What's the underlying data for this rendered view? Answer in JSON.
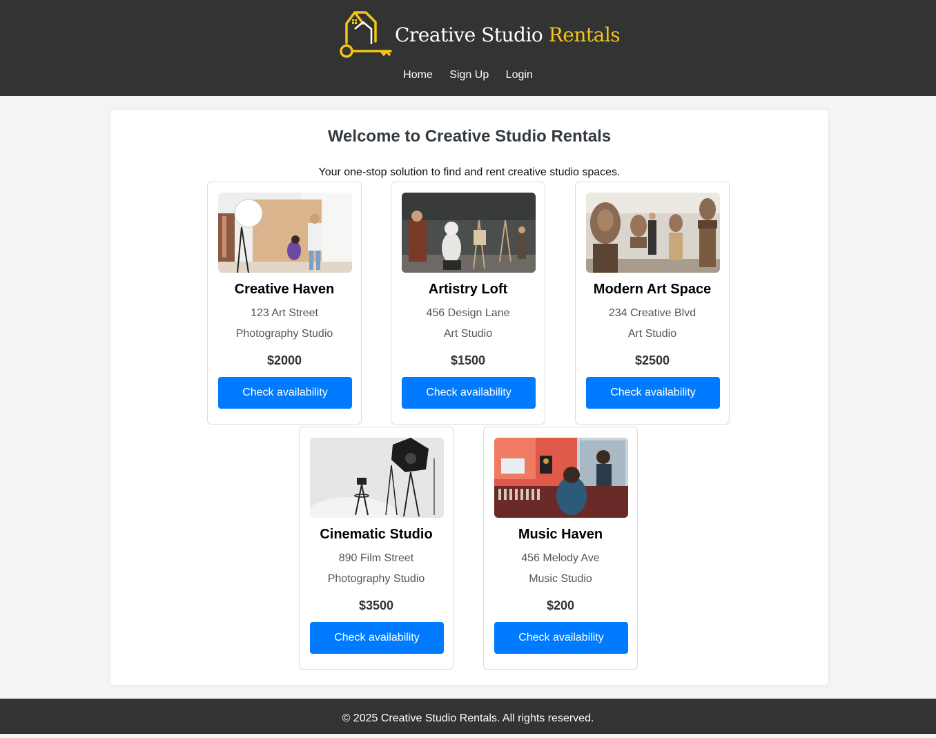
{
  "header": {
    "brand_primary": "Creative Studio",
    "brand_accent": "Rentals",
    "logo_icon": "house-key-icon",
    "accent_color": "#f5c518",
    "nav": [
      {
        "label": "Home"
      },
      {
        "label": "Sign Up"
      },
      {
        "label": "Login"
      }
    ]
  },
  "main": {
    "title": "Welcome to Creative Studio Rentals",
    "subtitle": "Your one-stop solution to find and rent creative studio spaces.",
    "button_color": "#007bff",
    "studios": [
      {
        "name": "Creative Haven",
        "address": "123 Art Street",
        "type": "Photography Studio",
        "price": "$2000",
        "button_label": "Check availability",
        "image": "photo-studio-photo"
      },
      {
        "name": "Artistry Loft",
        "address": "456 Design Lane",
        "type": "Art Studio",
        "price": "$1500",
        "button_label": "Check availability",
        "image": "art-loft-photo"
      },
      {
        "name": "Modern Art Space",
        "address": "234 Creative Blvd",
        "type": "Art Studio",
        "price": "$2500",
        "button_label": "Check availability",
        "image": "sculpture-studio-photo"
      },
      {
        "name": "Cinematic Studio",
        "address": "890 Film Street",
        "type": "Photography Studio",
        "price": "$3500",
        "button_label": "Check availability",
        "image": "lighting-studio-photo"
      },
      {
        "name": "Music Haven",
        "address": "456 Melody Ave",
        "type": "Music Studio",
        "price": "$200",
        "button_label": "Check availability",
        "image": "recording-studio-photo"
      }
    ]
  },
  "footer": {
    "text": "© 2025 Creative Studio Rentals. All rights reserved."
  }
}
